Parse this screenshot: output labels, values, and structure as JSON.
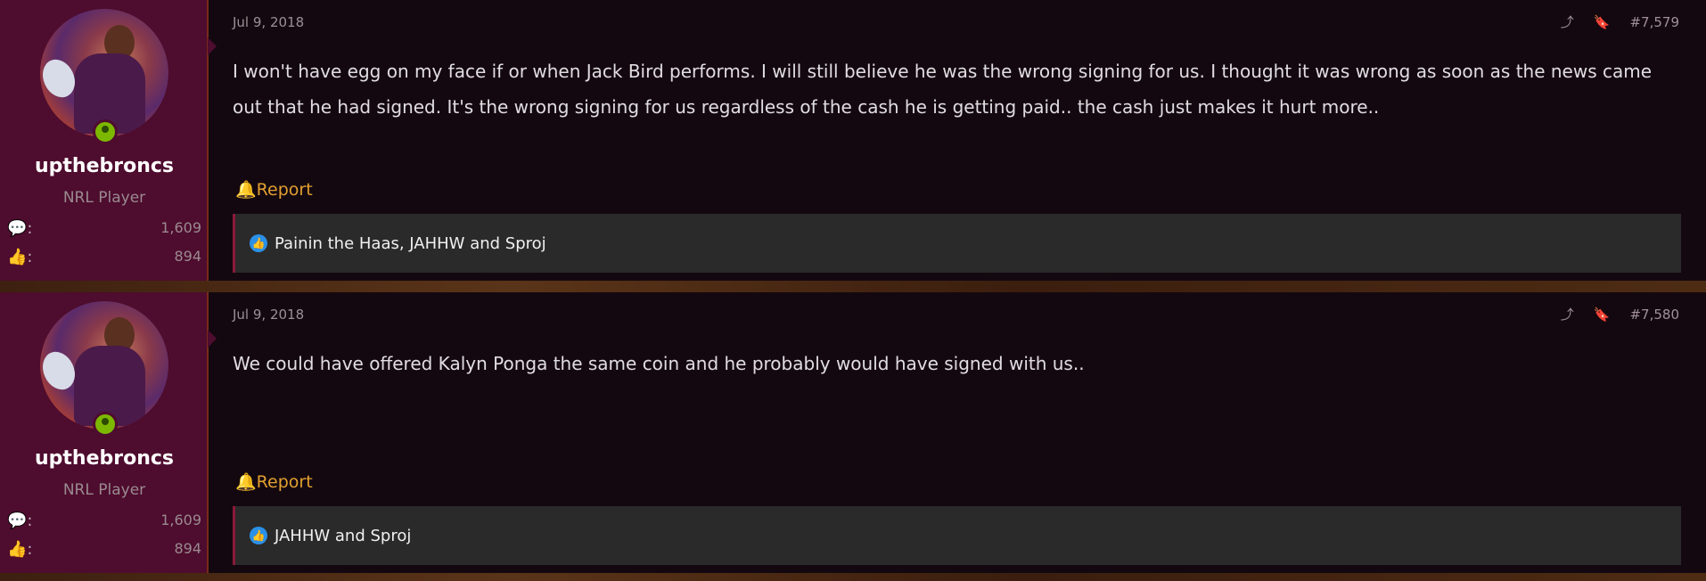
{
  "posts": [
    {
      "date": "Jul 9, 2018",
      "number": "#7,579",
      "username": "upthebroncs",
      "user_title": "NRL Player",
      "messages": "1,609",
      "reaction_score": "894",
      "body": "I won't have egg on my face if or when Jack Bird performs. I will still believe he was the wrong signing for us. I thought it was wrong as soon as the news came out that he had signed. It's the wrong signing for us regardless of the cash he is getting paid.. the cash just makes it hurt more..",
      "report_label": "Report",
      "reactions_text": "Painin the Haas, JAHHW and Sproj"
    },
    {
      "date": "Jul 9, 2018",
      "number": "#7,580",
      "username": "upthebroncs",
      "user_title": "NRL Player",
      "messages": "1,609",
      "reaction_score": "894",
      "body": "We could have offered Kalyn Ponga the same coin and he probably would have signed with us..",
      "report_label": "Report",
      "reactions_text": "JAHHW and Sproj"
    }
  ],
  "icons": {
    "messages": "speech-bubbles-icon",
    "reactions": "thumbs-up-icon",
    "share": "share-icon",
    "bookmark": "bookmark-icon",
    "report": "bell-icon",
    "like": "like-icon"
  },
  "colors": {
    "user_panel": "#4e0c2e",
    "post_bg": "#140810",
    "report": "#e2a030",
    "like": "#2a90e8"
  }
}
